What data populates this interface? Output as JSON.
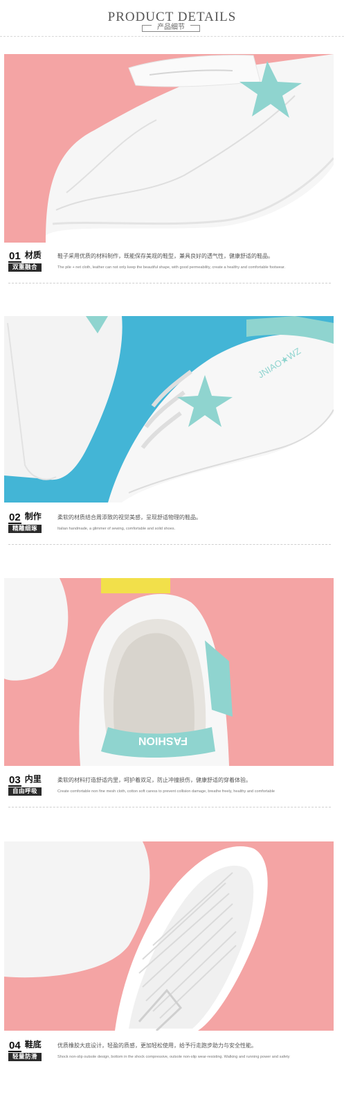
{
  "header": {
    "title": "PRODUCT DETAILS",
    "subtitle": "产品细节"
  },
  "colors": {
    "pink_bg": "#f4a4a4",
    "blue_bg": "#43b5d6",
    "mint_accent": "#8fd4cf",
    "tag_bg": "#2b2b2b"
  },
  "sections": [
    {
      "num": "01",
      "cn_title": "材质",
      "tag": "双重融合",
      "text_cn": "鞋子采用优质的材料制作，既能保存美观的鞋型，兼具良好的透气性，健康舒适的鞋品。",
      "text_en": "The pile + net cloth, leather can not only keep the beautiful shape, with good permeability, create a healthy and comfortable footwear."
    },
    {
      "num": "02",
      "cn_title": "制作",
      "tag": "精雕细琢",
      "text_cn": "柔软的材质结合周添致的视觉美感，呈现舒适物理的鞋品。",
      "text_en": "Italian handmade, a glimmer of sewing, comfortable and solid shoes."
    },
    {
      "num": "03",
      "cn_title": "内里",
      "tag": "自由呼吸",
      "text_cn": "柔软的材料打造舒适内里，呵护着双足，防止冲撞损伤，健康舒适的穿着体验。",
      "text_en": "Create comfortable non fine mesh cloth, cotton soft caress to prevent collision damage, breathe freely, healthy and comfortable"
    },
    {
      "num": "04",
      "cn_title": "鞋底",
      "tag": "轻量防滑",
      "text_cn": "优质橡胶大底设计，轻盈的质感，更加轻松使用，给予行走跑步助力与安全性能。",
      "text_en": "Shock non-slip outsole design, bottom in the shock compressive, outsole non-slip wear-resisting. Walking and running power and safety"
    }
  ],
  "photos": [
    {
      "icon": "shoe-toe-closeup-image"
    },
    {
      "icon": "shoe-side-star-image",
      "shoe_text": "JNIAO★WZ"
    },
    {
      "icon": "shoe-heel-insole-image",
      "shoe_text": "FASHION"
    },
    {
      "icon": "shoe-sole-tread-image"
    }
  ]
}
